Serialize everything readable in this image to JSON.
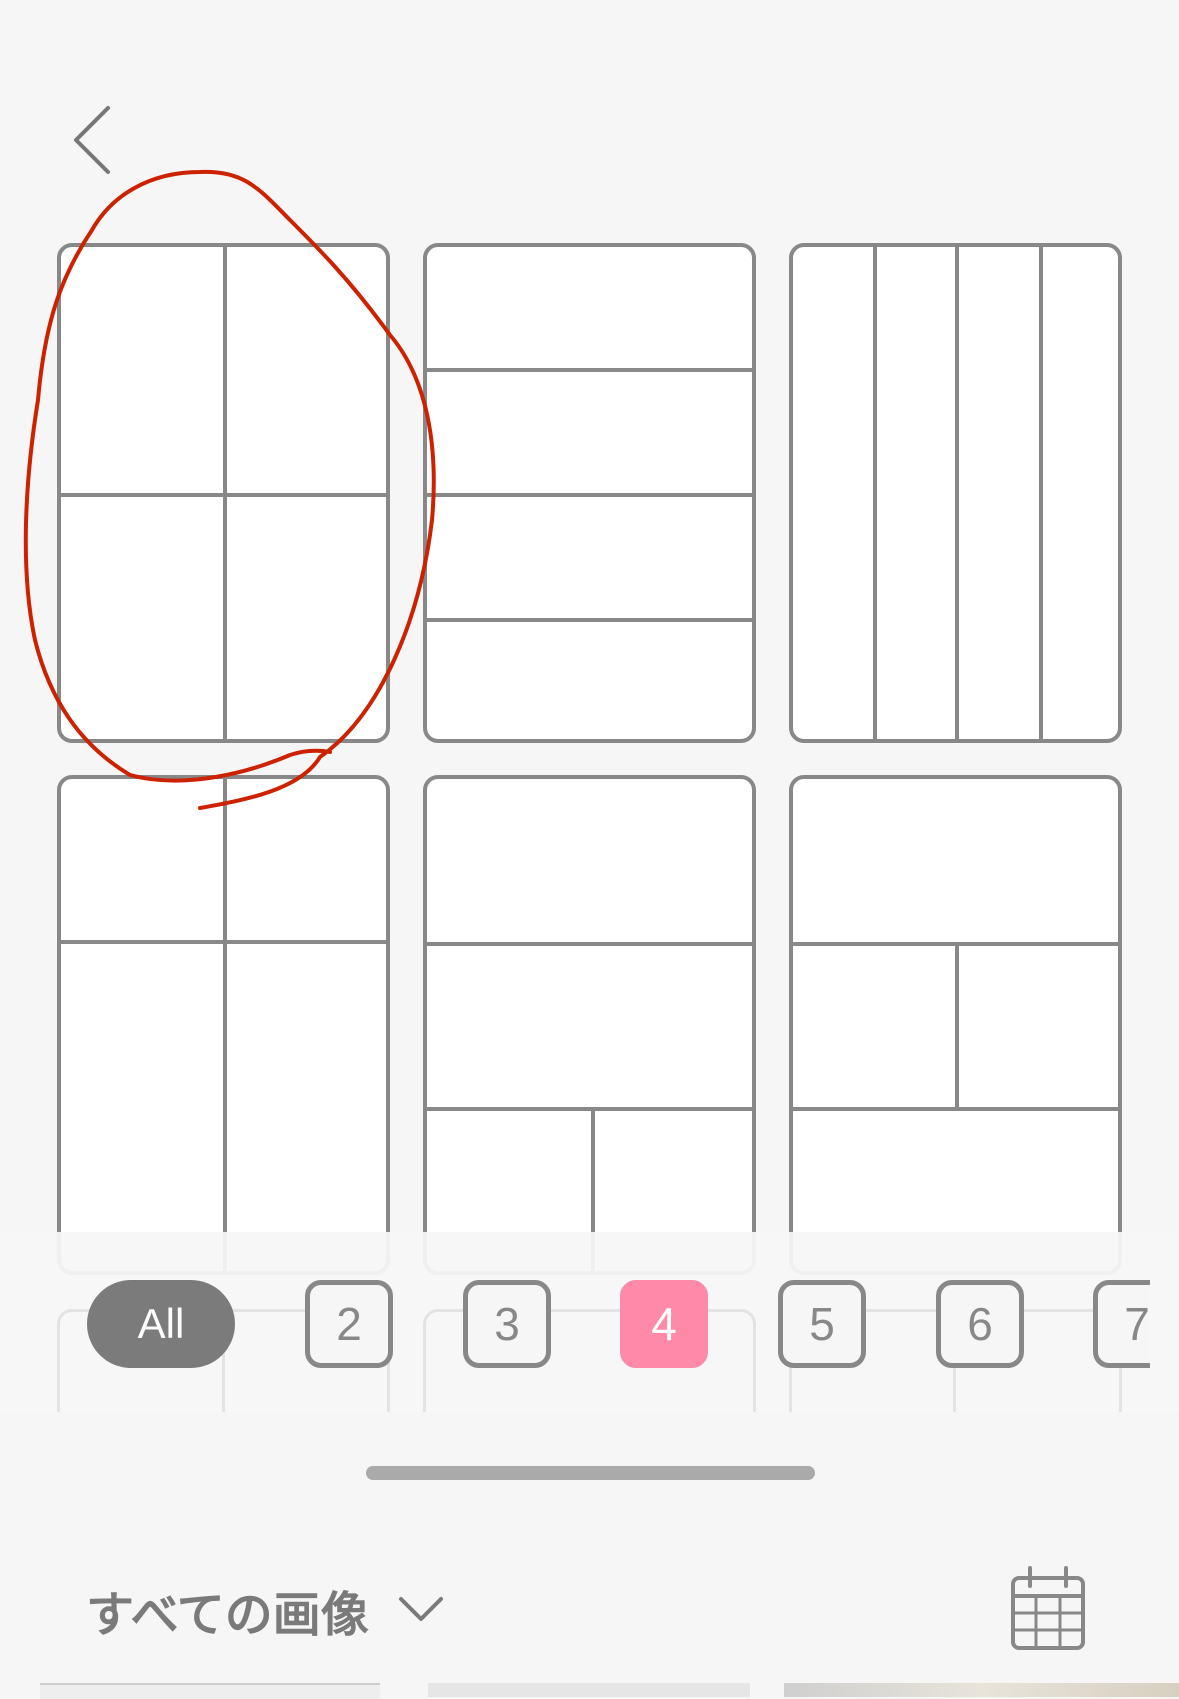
{
  "filters": {
    "all_label": "All",
    "numbers": [
      "2",
      "3",
      "4",
      "5",
      "6",
      "7"
    ],
    "active": "4"
  },
  "album": {
    "title": "すべての画像"
  },
  "colors": {
    "accent": "#ff8aa8",
    "chip_active_bg": "#7b7b7b",
    "outline": "#888888",
    "annotation": "#cc2200",
    "background": "#f6f6f6"
  },
  "icons": {
    "back": "chevron-left-icon",
    "dropdown": "chevron-down-icon",
    "calendar": "calendar-icon"
  },
  "layouts": [
    {
      "id": "grid-2x2",
      "highlighted": true
    },
    {
      "id": "rows-4"
    },
    {
      "id": "columns-4"
    },
    {
      "id": "top-pair-bottom-pair"
    },
    {
      "id": "two-rows-bottom-pair"
    },
    {
      "id": "top-row-middle-pair-bottom-row"
    }
  ]
}
